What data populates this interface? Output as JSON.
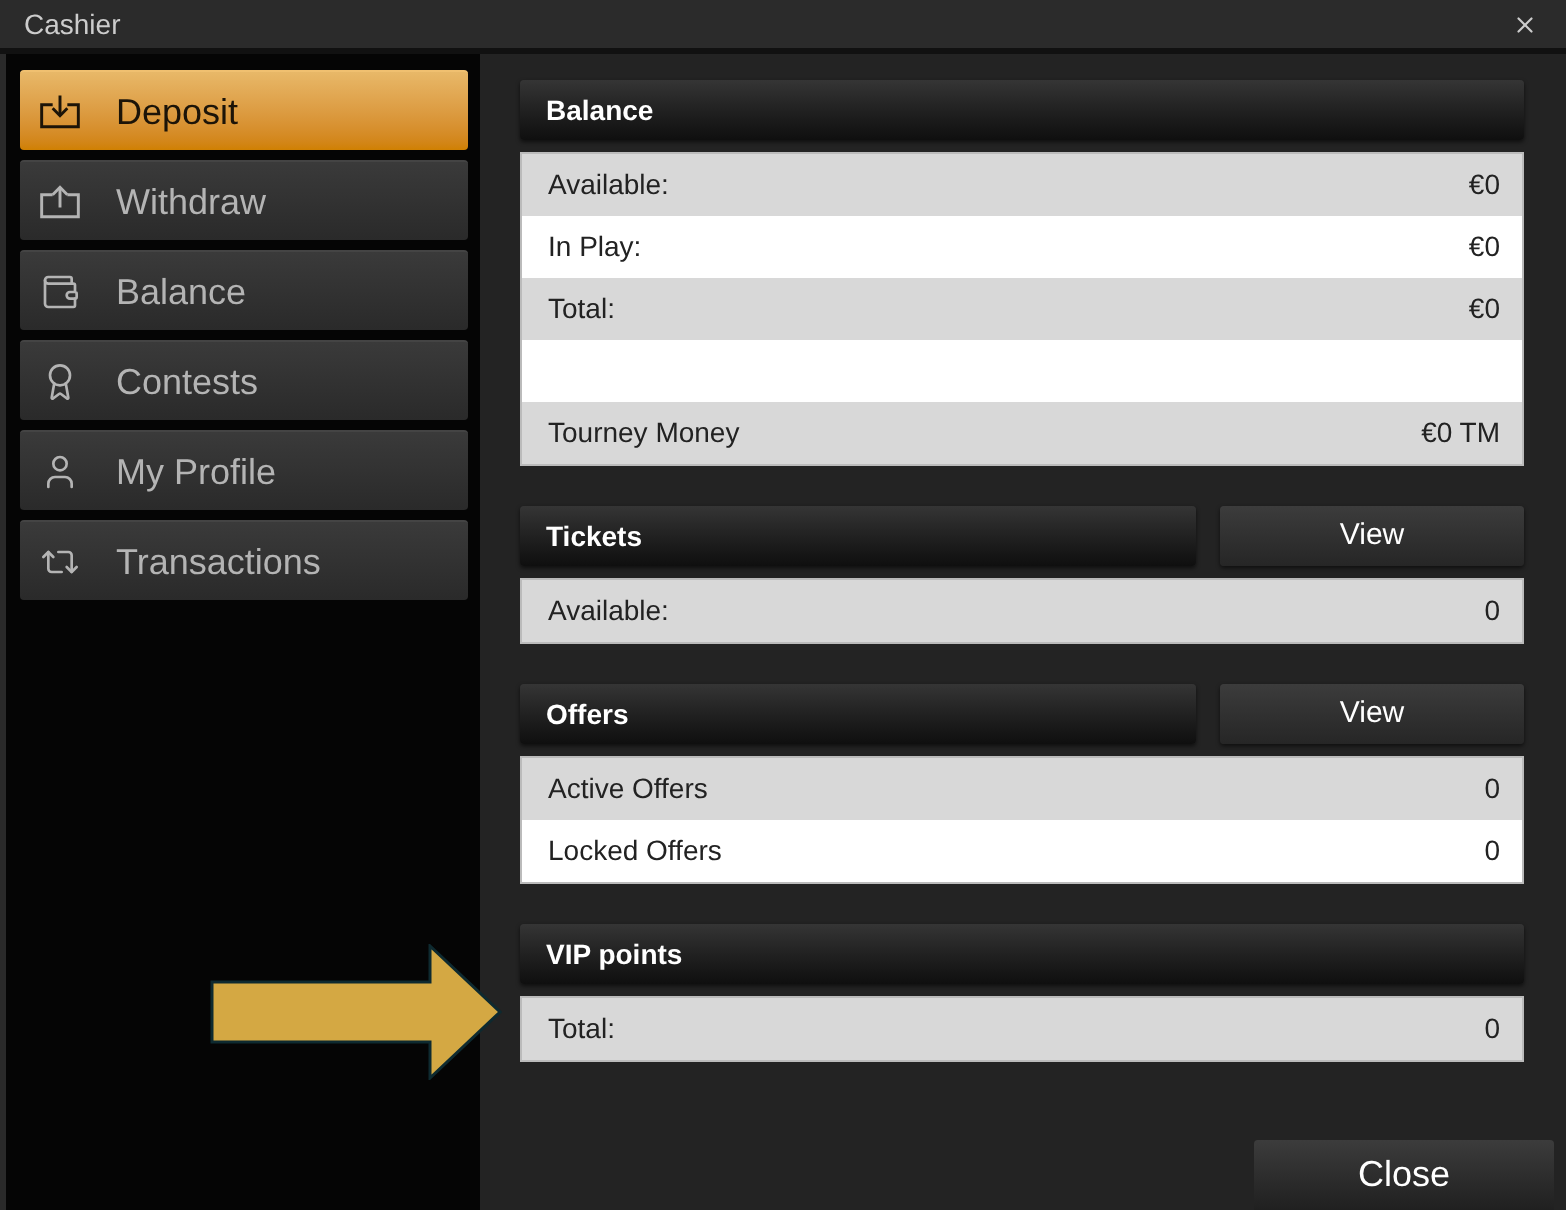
{
  "window": {
    "title": "Cashier"
  },
  "sidebar": {
    "items": [
      {
        "label": "Deposit",
        "selected": true
      },
      {
        "label": "Withdraw",
        "selected": false
      },
      {
        "label": "Balance",
        "selected": false
      },
      {
        "label": "Contests",
        "selected": false
      },
      {
        "label": "My Profile",
        "selected": false
      },
      {
        "label": "Transactions",
        "selected": false
      }
    ]
  },
  "sections": [
    {
      "title": "Balance",
      "rows": [
        {
          "kind": "entry",
          "label": "Available:",
          "value": "€0"
        },
        {
          "kind": "entry",
          "label": "In Play:",
          "value": "€0"
        },
        {
          "kind": "entry",
          "label": "Total:",
          "value": "€0"
        },
        {
          "kind": "blank"
        },
        {
          "kind": "entry",
          "label": "Tourney Money",
          "value": "€0 TM"
        }
      ]
    },
    {
      "title": "Tickets",
      "button": "View",
      "rows": [
        {
          "kind": "entry",
          "label": "Available:",
          "value": "0"
        }
      ]
    },
    {
      "title": "Offers",
      "button": "View",
      "rows": [
        {
          "kind": "entry",
          "label": "Active Offers",
          "value": "0"
        },
        {
          "kind": "entry",
          "label": "Locked Offers",
          "value": "0"
        }
      ]
    },
    {
      "title": "VIP points",
      "rows": [
        {
          "kind": "entry",
          "label": "Total:",
          "value": "0"
        }
      ]
    }
  ],
  "footer": {
    "close_button": "Close"
  }
}
